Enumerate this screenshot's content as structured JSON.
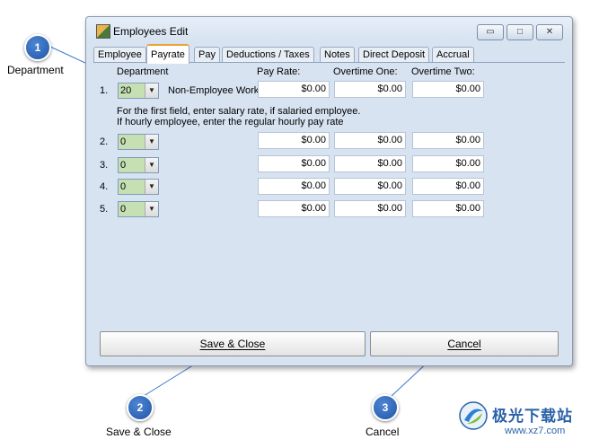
{
  "window": {
    "title": "Employees Edit",
    "minimize": "▭",
    "maximize": "□",
    "close": "✕"
  },
  "tabs": [
    {
      "label": "Employee"
    },
    {
      "label": "Payrate",
      "active": true
    },
    {
      "label": "Pay"
    },
    {
      "label": "Deductions / Taxes"
    },
    {
      "label": "Notes"
    },
    {
      "label": "Direct Deposit"
    },
    {
      "label": "Accrual"
    }
  ],
  "headers": {
    "department": "Department",
    "pay_rate": "Pay Rate:",
    "overtime_one": "Overtime One:",
    "overtime_two": "Overtime Two:"
  },
  "rows": [
    {
      "num": "1.",
      "department": "20",
      "dept_name": "Non-Employee Work",
      "pay_rate": "$0.00",
      "overtime_one": "$0.00",
      "overtime_two": "$0.00"
    },
    {
      "num": "2.",
      "department": "0",
      "dept_name": "",
      "pay_rate": "$0.00",
      "overtime_one": "$0.00",
      "overtime_two": "$0.00"
    },
    {
      "num": "3.",
      "department": "0",
      "dept_name": "",
      "pay_rate": "$0.00",
      "overtime_one": "$0.00",
      "overtime_two": "$0.00"
    },
    {
      "num": "4.",
      "department": "0",
      "dept_name": "",
      "pay_rate": "$0.00",
      "overtime_one": "$0.00",
      "overtime_two": "$0.00"
    },
    {
      "num": "5.",
      "department": "0",
      "dept_name": "",
      "pay_rate": "$0.00",
      "overtime_one": "$0.00",
      "overtime_two": "$0.00"
    }
  ],
  "hint_line1": "For the first field, enter salary rate, if salaried employee.",
  "hint_line2": "If hourly employee, enter the regular hourly pay rate",
  "buttons": {
    "save_close": "Save & Close",
    "cancel": "Cancel"
  },
  "callouts": [
    {
      "num": "1",
      "label": "Department"
    },
    {
      "num": "2",
      "label": "Save & Close"
    },
    {
      "num": "3",
      "label": "Cancel"
    }
  ],
  "watermark": {
    "line1": "极光下载站",
    "line2": "www.xz7.com"
  },
  "colors": {
    "window_bg": "#d7e3f1",
    "callout": "#2f6bc0",
    "combo_value_bg": "#c6e0b4"
  }
}
